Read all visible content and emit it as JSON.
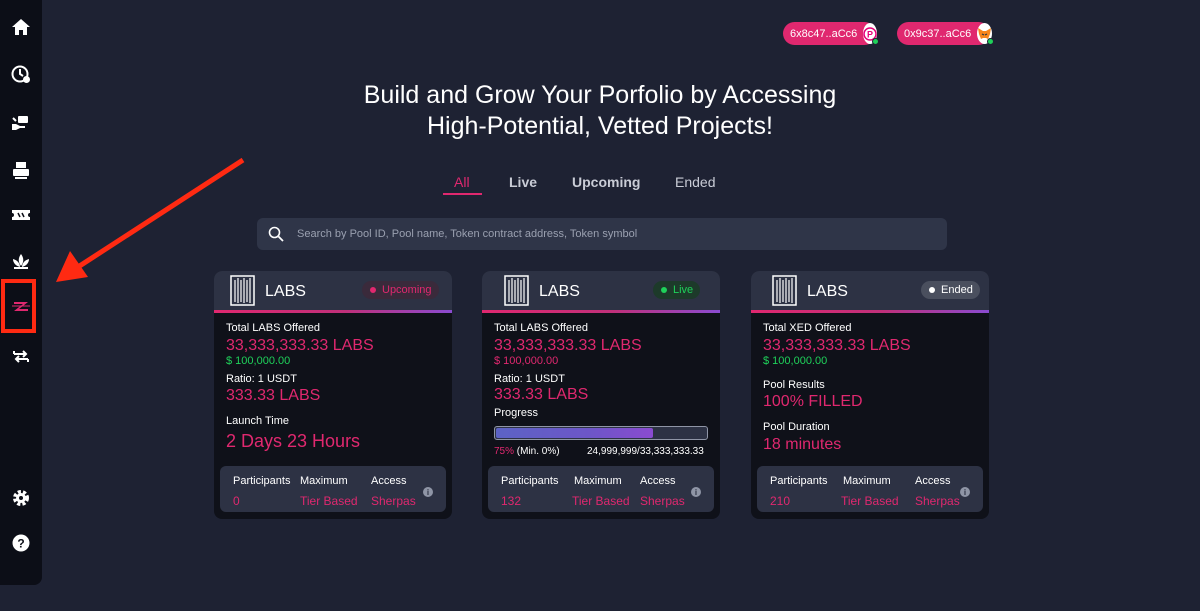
{
  "wallets": [
    {
      "address": "6x8c47..aCc6"
    },
    {
      "address": "0x9c37..aCc6"
    }
  ],
  "headline": {
    "line1": "Build and Grow Your Porfolio by Accessing",
    "line2": "High-Potential, Vetted Projects!"
  },
  "tabs": [
    {
      "label": "All",
      "active": true
    },
    {
      "label": "Live"
    },
    {
      "label": "Upcoming"
    },
    {
      "label": "Ended"
    }
  ],
  "search": {
    "placeholder": "Search by Pool ID, Pool name, Token contract address, Token symbol"
  },
  "sidebar": {
    "icons": [
      "home-icon",
      "clock-badge-icon",
      "hand-money-icon",
      "printer-icon",
      "ticket-icon",
      "lotus-icon",
      "z-logo-icon",
      "swap-arrows-icon",
      "gear-icon",
      "help-icon"
    ]
  },
  "cards": [
    {
      "name": "LABS",
      "status": "Upcoming",
      "status_color": "#e0286f",
      "offered_label": "Total LABS Offered",
      "offered_value": "33,333,333.33 LABS",
      "usd": "$ 100,000.00",
      "ratio_label": "Ratio: 1 USDT",
      "ratio_value": "333.33 LABS",
      "time_label": "Launch Time",
      "time_value": "2 Days 23 Hours",
      "stats": {
        "participants_label": "Participants",
        "participants": "0",
        "maximum_label": "Maximum",
        "maximum": "Tier Based",
        "access_label": "Access",
        "access": "Sherpas"
      }
    },
    {
      "name": "LABS",
      "status": "Live",
      "status_color": "#1fd15a",
      "offered_label": "Total LABS Offered",
      "offered_value": "33,333,333.33 LABS",
      "usd": "$ 100,000.00",
      "ratio_label": "Ratio: 1 USDT",
      "ratio_value": "333.33 LABS",
      "progress_label": "Progress",
      "progress_fraction": 0.75,
      "progress_pct": "75%",
      "progress_min": "(Min. 0%)",
      "progress_amount": "24,999,999/33,333,333.33",
      "stats": {
        "participants_label": "Participants",
        "participants": "132",
        "maximum_label": "Maximum",
        "maximum": "Tier Based",
        "access_label": "Access",
        "access": "Sherpas"
      }
    },
    {
      "name": "LABS",
      "status": "Ended",
      "status_color": "#ffffff",
      "offered_label": "Total XED Offered",
      "offered_value": "33,333,333.33 LABS",
      "usd": "$ 100,000.00",
      "results_label": "Pool Results",
      "results_value": "100% FILLED",
      "duration_label": "Pool Duration",
      "duration_value": "18 minutes",
      "stats": {
        "participants_label": "Participants",
        "participants": "210",
        "maximum_label": "Maximum",
        "maximum": "Tier Based",
        "access_label": "Access",
        "access": "Sherpas"
      }
    }
  ],
  "colors": {
    "accent": "#e0286f",
    "live": "#1fd15a",
    "background": "#1e2233",
    "card": "#0f1119",
    "annotation": "#ff2a12"
  }
}
